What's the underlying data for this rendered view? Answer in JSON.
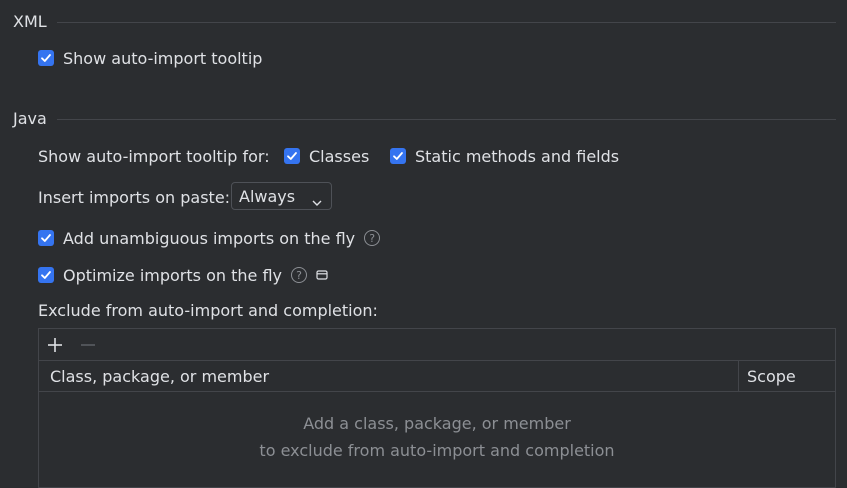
{
  "xml": {
    "title": "XML",
    "show_tooltip": {
      "label": "Show auto-import tooltip",
      "checked": true
    }
  },
  "java": {
    "title": "Java",
    "show_tooltip_for_label": "Show auto-import tooltip for:",
    "classes": {
      "label": "Classes",
      "checked": true
    },
    "static": {
      "label": "Static methods and fields",
      "checked": true
    },
    "insert_imports_label": "Insert imports on paste:",
    "insert_imports_value": "Always",
    "add_unambiguous": {
      "label": "Add unambiguous imports on the fly",
      "checked": true
    },
    "optimize": {
      "label": "Optimize imports on the fly",
      "checked": true
    },
    "exclude_label": "Exclude from auto-import and completion:",
    "table": {
      "columns": [
        "Class, package, or member",
        "Scope"
      ],
      "empty_line1": "Add a class, package, or member",
      "empty_line2": "to exclude from auto-import and completion"
    }
  },
  "icons": {
    "checkbox": "check-icon",
    "help": "help-icon",
    "window": "window-icon",
    "add": "plus-icon",
    "remove": "minus-icon",
    "dropdown": "chevron-down-icon"
  },
  "colors": {
    "background": "#2b2d30",
    "accent": "#3574f0",
    "text": "#dfe1e5",
    "muted": "#8c8f94",
    "border": "#43454a"
  }
}
